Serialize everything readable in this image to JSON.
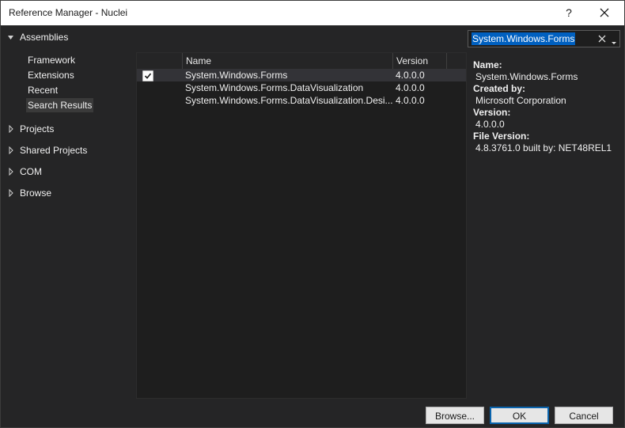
{
  "window": {
    "title": "Reference Manager - Nuclei",
    "help_label": "?"
  },
  "nav": {
    "assemblies_label": "Assemblies",
    "assembly_items": [
      "Framework",
      "Extensions",
      "Recent",
      "Search Results"
    ],
    "selected_item": "Search Results",
    "groups": [
      "Projects",
      "Shared Projects",
      "COM",
      "Browse"
    ]
  },
  "search": {
    "value": "System.Windows.Forms"
  },
  "list": {
    "columns": [
      "Name",
      "Version"
    ],
    "rows": [
      {
        "checked": true,
        "name": "System.Windows.Forms",
        "version": "4.0.0.0"
      },
      {
        "checked": false,
        "name": "System.Windows.Forms.DataVisualization",
        "version": "4.0.0.0"
      },
      {
        "checked": false,
        "name": "System.Windows.Forms.DataVisualization.Desi...",
        "version": "4.0.0.0"
      }
    ]
  },
  "details": {
    "name_label": "Name:",
    "name_value": "System.Windows.Forms",
    "created_label": "Created by:",
    "created_value": "Microsoft Corporation",
    "version_label": "Version:",
    "version_value": "4.0.0.0",
    "file_version_label": "File Version:",
    "file_version_value": "4.8.3761.0 built by: NET48REL1"
  },
  "footer": {
    "browse_label": "Browse...",
    "ok_label": "OK",
    "cancel_label": "Cancel"
  },
  "colors": {
    "accent": "#0060c0",
    "background": "#252526",
    "list_background": "#1e1e1e"
  },
  "icons": [
    "close-icon",
    "expand-arrow-icon",
    "collapse-arrow-icon",
    "check-icon",
    "clear-icon",
    "dropdown-icon"
  ]
}
